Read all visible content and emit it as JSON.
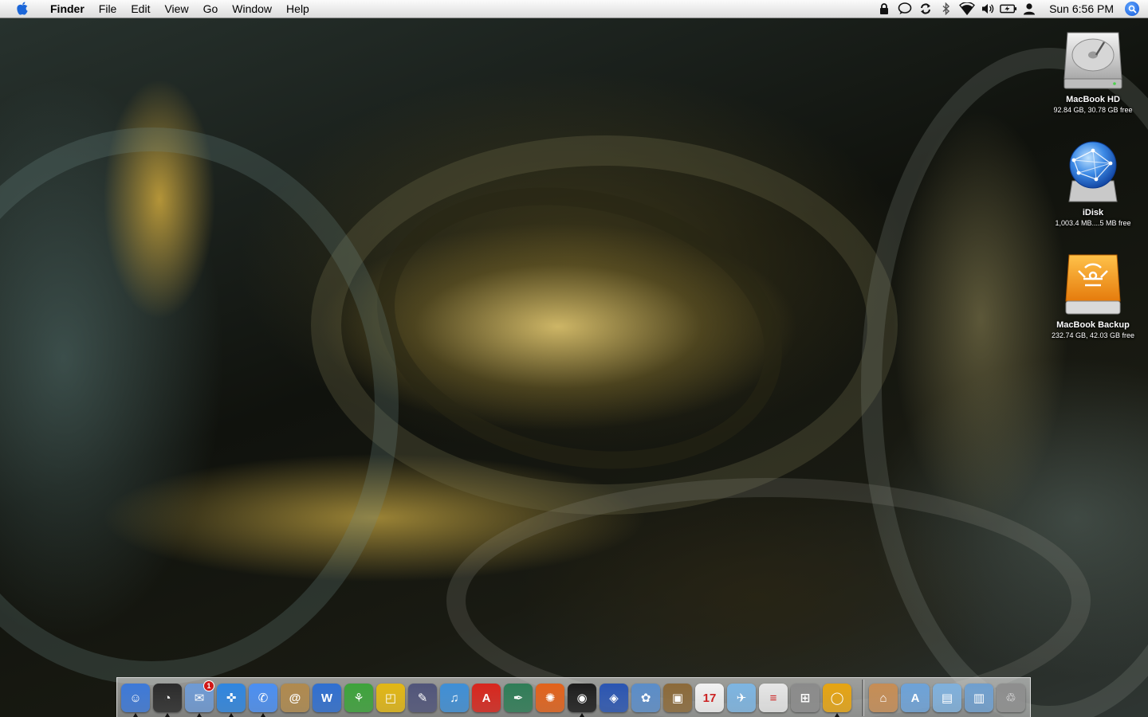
{
  "menubar": {
    "apple_icon": "apple-icon",
    "items": [
      "Finder",
      "File",
      "Edit",
      "View",
      "Go",
      "Window",
      "Help"
    ],
    "status_icons": [
      "lock-icon",
      "chat-bubble-icon",
      "sync-icon",
      "bluetooth-icon",
      "wifi-icon",
      "volume-icon",
      "battery-icon",
      "user-icon"
    ],
    "clock": "Sun 6:56 PM",
    "spotlight_icon": "spotlight-search-icon"
  },
  "desktop": {
    "icons": [
      {
        "name": "MacBook HD",
        "info": "92.84 GB, 30.78 GB free",
        "icon": "hard-drive-icon"
      },
      {
        "name": "iDisk",
        "info": "1,003.4 MB....5 MB free",
        "icon": "idisk-icon"
      },
      {
        "name": "MacBook Backup",
        "info": "232.74 GB, 42.03 GB free",
        "icon": "external-drive-icon"
      }
    ]
  },
  "dock": {
    "apps": [
      {
        "icon": "finder-icon",
        "glyph": "☺",
        "color": "#3d79d8",
        "running": true
      },
      {
        "icon": "dashboard-icon",
        "glyph": "◔",
        "color": "#2b2b2b",
        "running": true
      },
      {
        "icon": "mail-icon",
        "glyph": "✉",
        "color": "#6e9ad4",
        "running": true,
        "badge": "1"
      },
      {
        "icon": "safari-icon",
        "glyph": "✜",
        "color": "#2f86e0",
        "running": true
      },
      {
        "icon": "ichat-icon",
        "glyph": "✆",
        "color": "#4b8ff2",
        "running": true
      },
      {
        "icon": "address-book-icon",
        "glyph": "@",
        "color": "#b08a4e",
        "running": false
      },
      {
        "icon": "word-icon",
        "glyph": "W",
        "color": "#2f6fd1",
        "running": false
      },
      {
        "icon": "omnigraffle-icon",
        "glyph": "⚘",
        "color": "#3da33b",
        "running": false
      },
      {
        "icon": "pages-icon",
        "glyph": "◰",
        "color": "#e2b714",
        "running": false
      },
      {
        "icon": "script-editor-icon",
        "glyph": "✎",
        "color": "#51557a",
        "running": false
      },
      {
        "icon": "itunes-icon",
        "glyph": "♫",
        "color": "#3f8fd6",
        "running": false
      },
      {
        "icon": "acrobat-icon",
        "glyph": "A",
        "color": "#d8261d",
        "running": false
      },
      {
        "icon": "feather-icon",
        "glyph": "✒",
        "color": "#2f7d57",
        "running": false
      },
      {
        "icon": "pinwheel-icon",
        "glyph": "✺",
        "color": "#e2621b",
        "running": false
      },
      {
        "icon": "aperture-icon",
        "glyph": "◉",
        "color": "#1c1c1c",
        "running": true
      },
      {
        "icon": "eye-icon",
        "glyph": "◈",
        "color": "#2a55b2",
        "running": false
      },
      {
        "icon": "iphoto-icon",
        "glyph": "✿",
        "color": "#5b8dc9",
        "running": false
      },
      {
        "icon": "photo-presentation-icon",
        "glyph": "▣",
        "color": "#8c6a3a",
        "running": false
      },
      {
        "icon": "ical-icon",
        "glyph": "17",
        "color": "#f2f2f2",
        "running": false
      },
      {
        "icon": "mail-stamp-icon",
        "glyph": "✈",
        "color": "#7db5e2",
        "running": false
      },
      {
        "icon": "textedit-icon",
        "glyph": "≡",
        "color": "#e6e6e6",
        "running": false
      },
      {
        "icon": "calculator-icon",
        "glyph": "⊞",
        "color": "#8b8b8b",
        "running": false
      },
      {
        "icon": "yellow-ring-icon",
        "glyph": "◯",
        "color": "#e6a412",
        "running": true
      }
    ],
    "right_items": [
      {
        "icon": "home-folder-icon",
        "glyph": "⌂",
        "color": "#c68d55"
      },
      {
        "icon": "applications-folder-icon",
        "glyph": "A",
        "color": "#6da2d8"
      },
      {
        "icon": "documents-folder-icon",
        "glyph": "▤",
        "color": "#7fb0dc"
      },
      {
        "icon": "pictures-folder-icon",
        "glyph": "▥",
        "color": "#6f9fcf"
      },
      {
        "icon": "trash-icon",
        "glyph": "♲",
        "color": "#8e8e8e"
      }
    ]
  }
}
